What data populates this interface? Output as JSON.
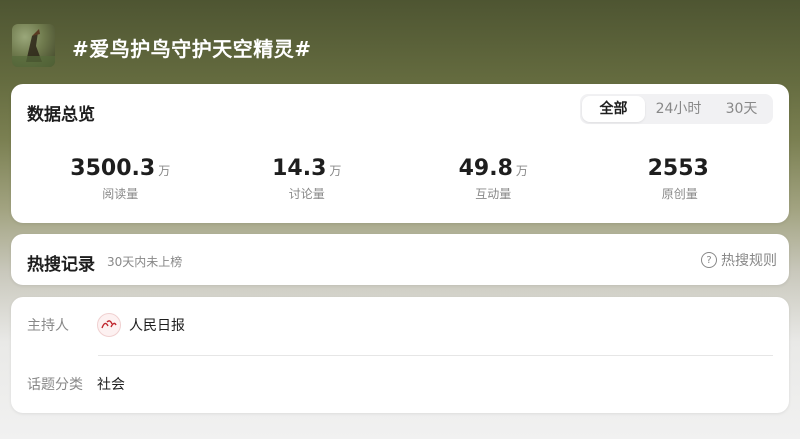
{
  "topic": {
    "title": "#爱鸟护鸟守护天空精灵#",
    "thumb_icon": "bird-photo-thumbnail"
  },
  "overview": {
    "title": "数据总览",
    "tabs": [
      {
        "label": "全部",
        "active": true
      },
      {
        "label": "24小时",
        "active": false
      },
      {
        "label": "30天",
        "active": false
      }
    ],
    "stats": [
      {
        "value": "3500.3",
        "unit": "万",
        "label": "阅读量"
      },
      {
        "value": "14.3",
        "unit": "万",
        "label": "讨论量"
      },
      {
        "value": "49.8",
        "unit": "万",
        "label": "互动量"
      },
      {
        "value": "2553",
        "unit": "",
        "label": "原创量"
      }
    ]
  },
  "hot_search": {
    "title": "热搜记录",
    "subtitle": "30天内未上榜",
    "rules_label": "热搜规则",
    "rules_icon": "question-circle-icon"
  },
  "info": {
    "host_label": "主持人",
    "host_name": "人民日报",
    "category_label": "话题分类",
    "category_value": "社会"
  },
  "colors": {
    "text_primary": "#1e1e1e",
    "text_secondary": "#888888",
    "card_bg": "#ffffff"
  }
}
